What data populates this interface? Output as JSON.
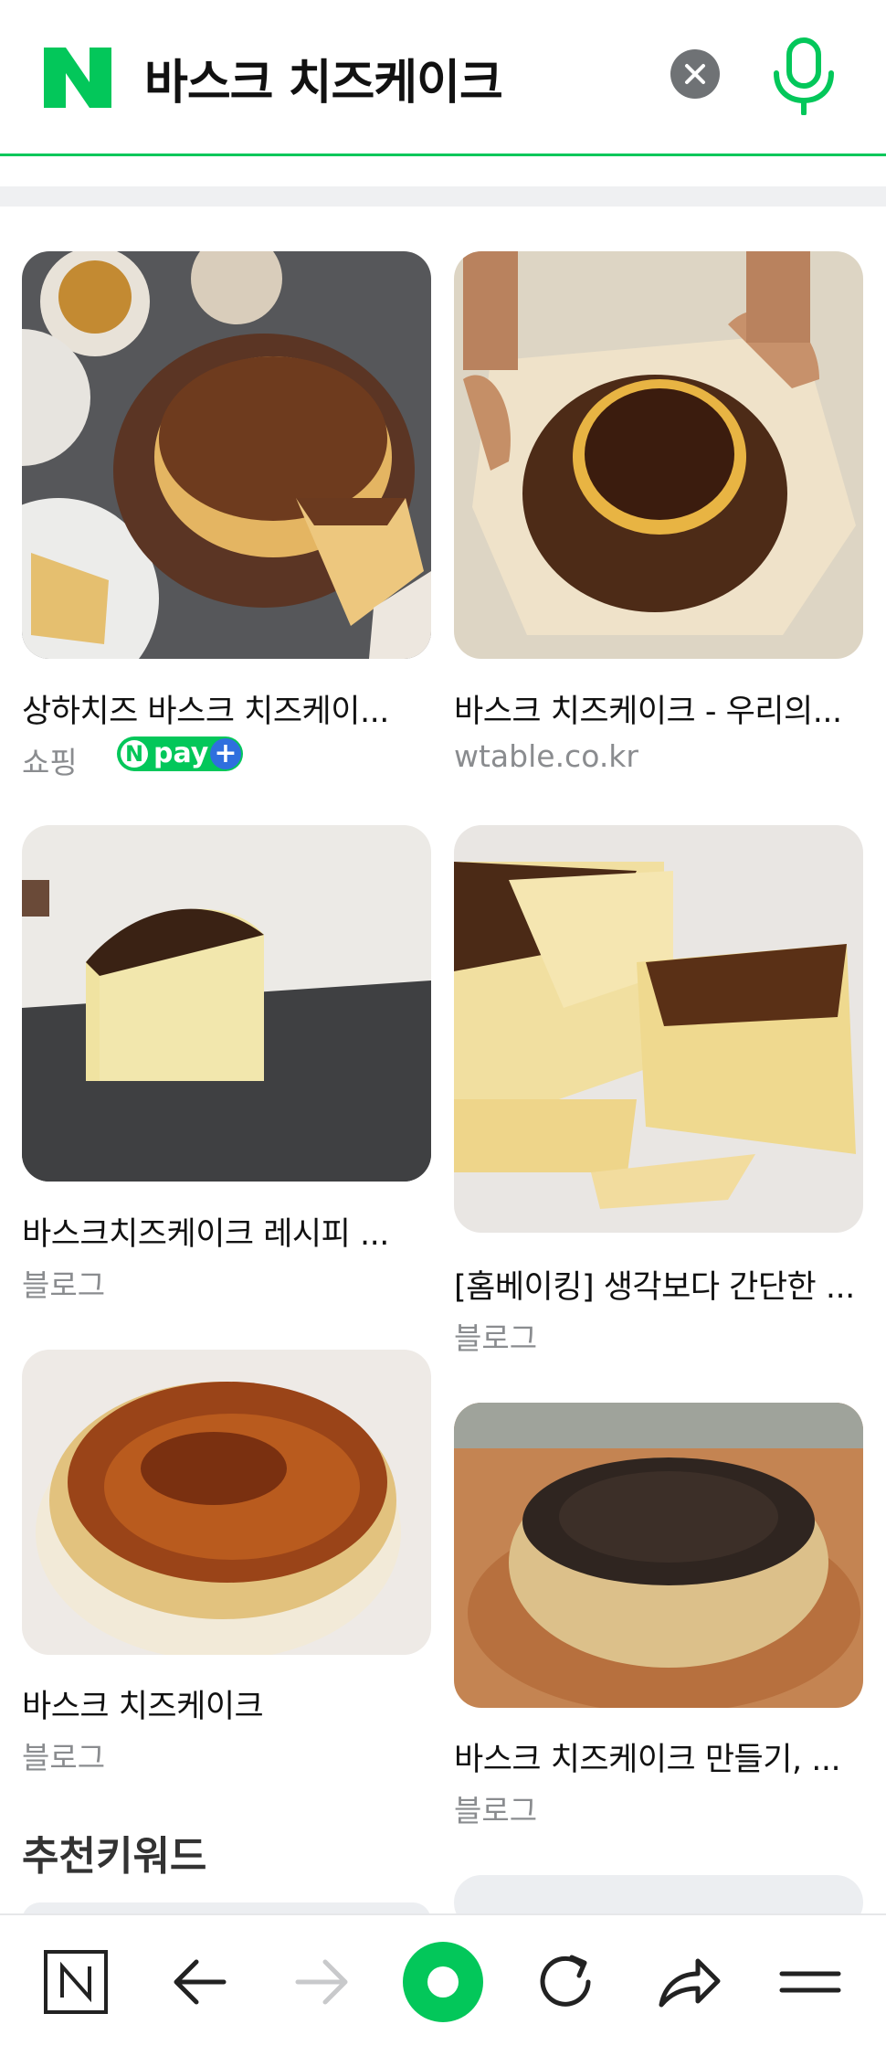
{
  "search": {
    "query": "바스크 치즈케이크",
    "clear_icon": "close-icon",
    "mic_icon": "microphone-icon",
    "brand_color": "#03c75a"
  },
  "results": [
    {
      "title": "상하치즈 바스크 치즈케이...",
      "source": "쇼핑",
      "badge": {
        "n": "N",
        "pay": "pay",
        "plus": "+"
      }
    },
    {
      "title": "바스크 치즈케이크 - 우리의...",
      "source": "wtable.co.kr"
    },
    {
      "title": "바스크치즈케이크 레시피 ...",
      "source": "블로그"
    },
    {
      "title": "[홈베이킹] 생각보다 간단한 ...",
      "source": "블로그"
    },
    {
      "title": "바스크 치즈케이크",
      "source": "블로그"
    },
    {
      "title": "바스크 치즈케이크 만들기, ...",
      "source": "블로그"
    }
  ],
  "recommended": {
    "title": "추천키워드"
  },
  "bottom_nav": [
    "naver-home-icon",
    "back-arrow-icon",
    "forward-arrow-icon",
    "green-dot-button-icon",
    "refresh-icon",
    "share-icon",
    "menu-icon"
  ]
}
